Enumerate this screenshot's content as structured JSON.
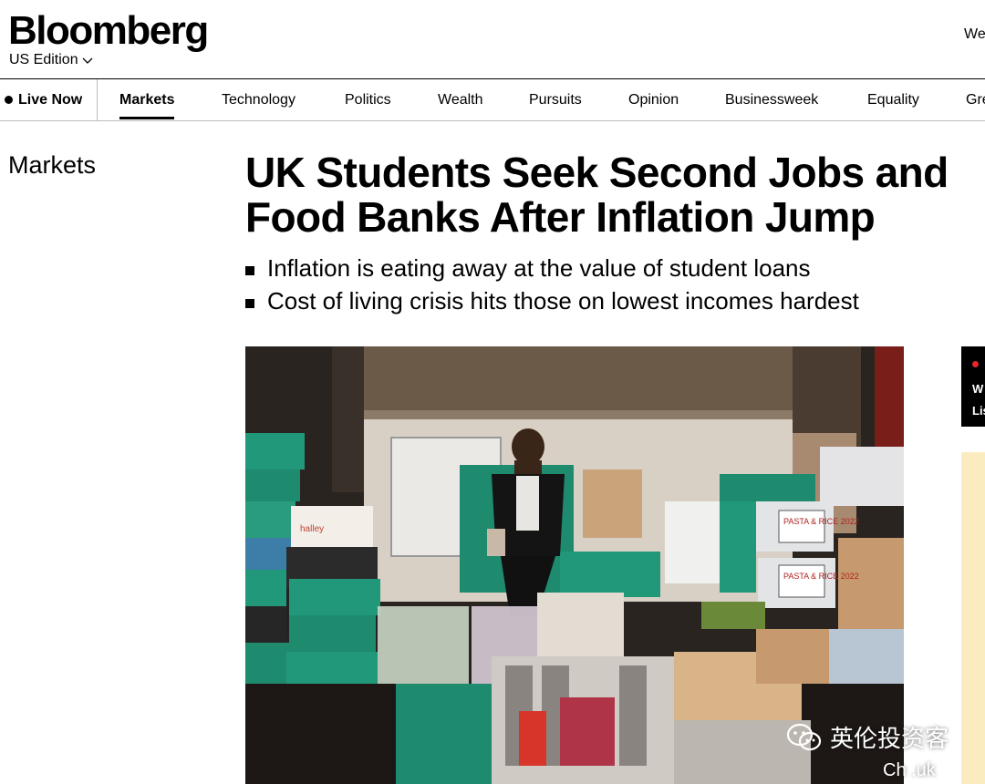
{
  "header": {
    "logo": "Bloomberg",
    "edition": "US Edition",
    "welcome_partial": "We"
  },
  "nav": {
    "live_label": "Live Now",
    "items": [
      {
        "label": "Markets",
        "active": true
      },
      {
        "label": "Technology"
      },
      {
        "label": "Politics"
      },
      {
        "label": "Wealth"
      },
      {
        "label": "Pursuits"
      },
      {
        "label": "Opinion"
      },
      {
        "label": "Businessweek"
      },
      {
        "label": "Equality"
      },
      {
        "label": "Gre"
      }
    ]
  },
  "article": {
    "section": "Markets",
    "headline_line1": "UK Students Seek Second Jobs and",
    "headline_line2": "Food Banks After Inflation Jump",
    "bullets": [
      "Inflation is eating away at the value of student loans",
      "Cost of living crisis hits those on lowest incomes hardest"
    ],
    "photo_signs": [
      "PASTA & RICE 2022",
      "PASTA & RICE 2022"
    ],
    "photo_box_text": "halley"
  },
  "right_rail": {
    "live_card_line1": "W",
    "live_card_line2": "Lis",
    "accent_color": "#e8262b",
    "ad_color": "#fbecc0"
  },
  "watermark": {
    "text": "英伦投资客",
    "url_partial": "Ch          .uk"
  }
}
